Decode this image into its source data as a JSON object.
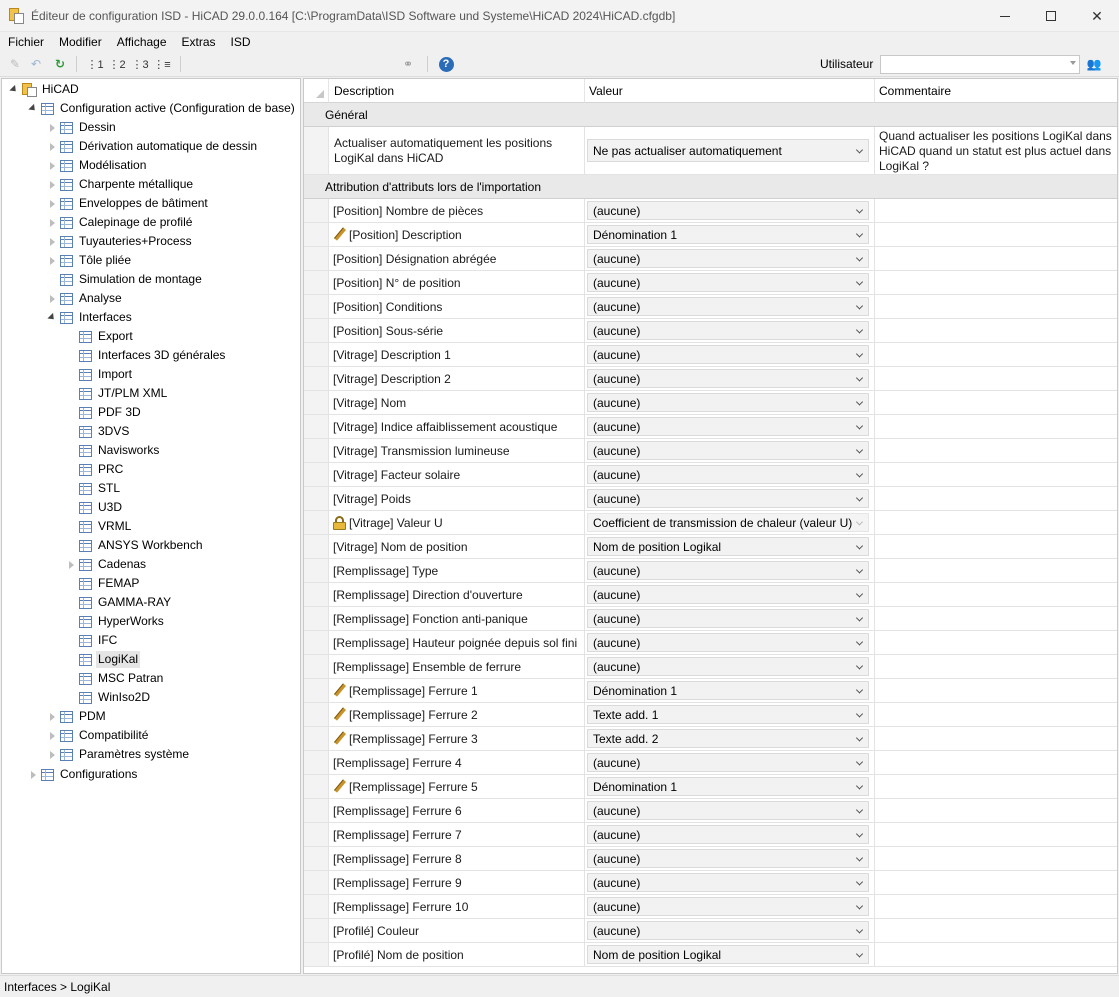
{
  "window": {
    "title": "Éditeur de configuration ISD  - HiCAD 29.0.0.164 [C:\\ProgramData\\ISD Software und Systeme\\HiCAD 2024\\HiCAD.cfgdb]"
  },
  "menu": [
    "Fichier",
    "Modifier",
    "Affichage",
    "Extras",
    "ISD"
  ],
  "toolbar": {
    "user_label": "Utilisateur",
    "user_value": ""
  },
  "tree": {
    "root": "HiCAD",
    "active": "Configuration active (Configuration de base)",
    "level1": [
      "Dessin",
      "Dérivation automatique de dessin",
      "Modélisation",
      "Charpente métallique",
      "Enveloppes de bâtiment",
      "Calepinage de profilé",
      "Tuyauteries+Process",
      "Tôle pliée",
      "Simulation de montage",
      "Analyse",
      "Interfaces"
    ],
    "interfaces": [
      "Export",
      "Interfaces 3D générales",
      "Import",
      "JT/PLM XML",
      "PDF 3D",
      "3DVS",
      "Navisworks",
      "PRC",
      "STL",
      "U3D",
      "VRML",
      "ANSYS Workbench",
      "Cadenas",
      "FEMAP",
      "GAMMA-RAY",
      "HyperWorks",
      "IFC",
      "LogiKal",
      "MSC Patran",
      "WinIso2D"
    ],
    "level1_after": [
      "PDM",
      "Compatibilité",
      "Paramètres système"
    ],
    "configurations": "Configurations"
  },
  "grid": {
    "headers": {
      "description": "Description",
      "value": "Valeur",
      "comment": "Commentaire"
    },
    "section_general": "Général",
    "general_row": {
      "description": "Actualiser automatiquement les positions LogiKal dans HiCAD",
      "value": "Ne pas actualiser automatiquement",
      "comment": "Quand actualiser les positions LogiKal dans HiCAD quand un statut est plus actuel dans LogiKal ?"
    },
    "section_import": "Attribution d'attributs lors de l'importation",
    "rows": [
      {
        "description": "[Position] Nombre de pièces",
        "value": "(aucune)",
        "icon": ""
      },
      {
        "description": "[Position] Description",
        "value": "Dénomination 1",
        "icon": "pencil"
      },
      {
        "description": "[Position] Désignation abrégée",
        "value": "(aucune)",
        "icon": ""
      },
      {
        "description": "[Position] N° de position",
        "value": "(aucune)",
        "icon": ""
      },
      {
        "description": "[Position] Conditions",
        "value": "(aucune)",
        "icon": ""
      },
      {
        "description": "[Position] Sous-série",
        "value": "(aucune)",
        "icon": ""
      },
      {
        "description": "[Vitrage] Description 1",
        "value": "(aucune)",
        "icon": ""
      },
      {
        "description": "[Vitrage] Description 2",
        "value": "(aucune)",
        "icon": ""
      },
      {
        "description": "[Vitrage] Nom",
        "value": "(aucune)",
        "icon": ""
      },
      {
        "description": "[Vitrage] Indice affaiblissement acoustique",
        "value": "(aucune)",
        "icon": ""
      },
      {
        "description": "[Vitrage] Transmission lumineuse",
        "value": "(aucune)",
        "icon": ""
      },
      {
        "description": "[Vitrage] Facteur solaire",
        "value": "(aucune)",
        "icon": ""
      },
      {
        "description": "[Vitrage] Poids",
        "value": "(aucune)",
        "icon": ""
      },
      {
        "description": "[Vitrage] Valeur U",
        "value": "Coefficient de transmission de chaleur (valeur U)",
        "icon": "lock"
      },
      {
        "description": "[Vitrage] Nom de position",
        "value": "Nom de position Logikal",
        "icon": ""
      },
      {
        "description": "[Remplissage] Type",
        "value": "(aucune)",
        "icon": ""
      },
      {
        "description": "[Remplissage] Direction d'ouverture",
        "value": "(aucune)",
        "icon": ""
      },
      {
        "description": "[Remplissage] Fonction anti-panique",
        "value": "(aucune)",
        "icon": ""
      },
      {
        "description": "[Remplissage] Hauteur poignée depuis sol fini",
        "value": "(aucune)",
        "icon": ""
      },
      {
        "description": "[Remplissage] Ensemble de ferrure",
        "value": "(aucune)",
        "icon": ""
      },
      {
        "description": "[Remplissage] Ferrure 1",
        "value": "Dénomination 1",
        "icon": "pencil"
      },
      {
        "description": "[Remplissage] Ferrure 2",
        "value": "Texte add. 1",
        "icon": "pencil"
      },
      {
        "description": "[Remplissage] Ferrure 3",
        "value": "Texte add. 2",
        "icon": "pencil"
      },
      {
        "description": "[Remplissage] Ferrure 4",
        "value": "(aucune)",
        "icon": ""
      },
      {
        "description": "[Remplissage] Ferrure 5",
        "value": "Dénomination 1",
        "icon": "pencil"
      },
      {
        "description": "[Remplissage] Ferrure 6",
        "value": "(aucune)",
        "icon": ""
      },
      {
        "description": "[Remplissage] Ferrure 7",
        "value": "(aucune)",
        "icon": ""
      },
      {
        "description": "[Remplissage] Ferrure 8",
        "value": "(aucune)",
        "icon": ""
      },
      {
        "description": "[Remplissage] Ferrure 9",
        "value": "(aucune)",
        "icon": ""
      },
      {
        "description": "[Remplissage] Ferrure 10",
        "value": "(aucune)",
        "icon": ""
      },
      {
        "description": "[Profilé] Couleur",
        "value": "(aucune)",
        "icon": ""
      },
      {
        "description": "[Profilé] Nom de position",
        "value": "Nom de position Logikal",
        "icon": ""
      }
    ]
  },
  "status": {
    "breadcrumb": "Interfaces > LogiKal"
  }
}
